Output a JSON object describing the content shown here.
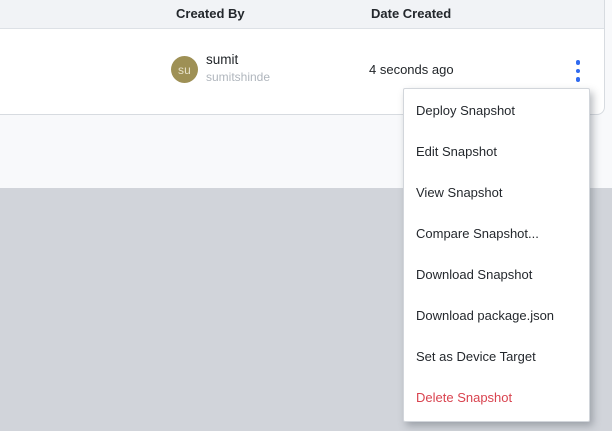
{
  "table": {
    "header": {
      "created_by": "Created By",
      "date_created": "Date Created"
    },
    "row": {
      "avatar_initials": "su",
      "name": "sumit",
      "username": "sumitshinde",
      "created_ago": "4 seconds ago"
    }
  },
  "menu": {
    "items": [
      {
        "label": "Deploy Snapshot"
      },
      {
        "label": "Edit Snapshot"
      },
      {
        "label": "View Snapshot"
      },
      {
        "label": "Compare Snapshot..."
      },
      {
        "label": "Download Snapshot"
      },
      {
        "label": "Download package.json"
      },
      {
        "label": "Set as Device Target"
      },
      {
        "label": "Delete Snapshot",
        "danger": true
      }
    ]
  },
  "icons": {
    "row_actions": "kebab-menu-icon"
  },
  "colors": {
    "accent_blue": "#2f6af0",
    "danger_red": "#d9434f",
    "avatar_olive": "#9e9055",
    "page_gray": "#d1d4da",
    "header_bg": "#f1f3f6"
  }
}
